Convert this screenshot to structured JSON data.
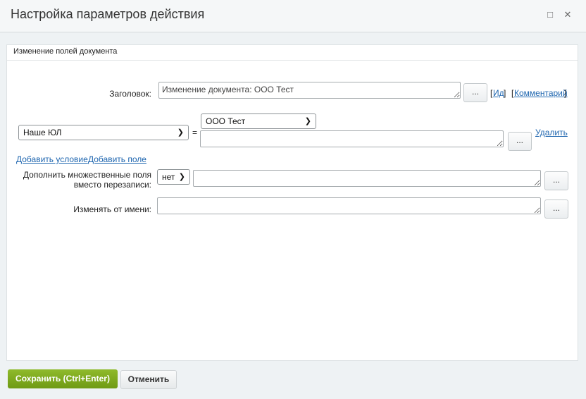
{
  "window": {
    "title": "Настройка параметров действия",
    "minimize_icon": "□",
    "close_icon": "✕"
  },
  "section": {
    "title": "Изменение полей документа"
  },
  "form": {
    "heading_label": "Заголовок:",
    "heading_value": "Изменение документа: ООО Тест",
    "dots": "...",
    "id_link": "Ид",
    "comment_link": "Комментарий",
    "bracket_open": "[",
    "bracket_close": "]",
    "field_select": "Наше ЮЛ",
    "equals": "=",
    "value_select": "ООО Тест",
    "value_text": "",
    "delete_link": "Удалить",
    "add_condition_link": "Добавить условие",
    "add_field_link": "Добавить поле",
    "multiple_label_line1": "Дополнить множественные поля",
    "multiple_label_line2": "вместо перезаписи:",
    "multiple_select": "нет",
    "multiple_text": "",
    "modify_by_label": "Изменять от имени:",
    "modify_by_text": ""
  },
  "footer": {
    "save_label": "Сохранить (Ctrl+Enter)",
    "cancel_label": "Отменить"
  }
}
